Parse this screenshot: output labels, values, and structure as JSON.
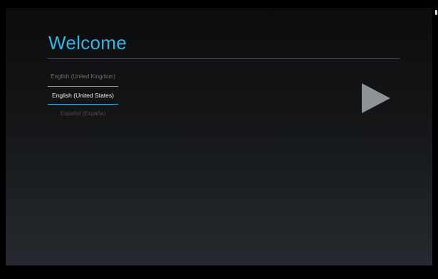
{
  "welcome": {
    "title": "Welcome"
  },
  "languages": {
    "items": [
      {
        "label": "English (United Kingdom)"
      },
      {
        "label": "English (United States)"
      },
      {
        "label": "Español (España)"
      }
    ],
    "selected": "English (United States)"
  },
  "next": {
    "icon": "play-arrow-icon"
  },
  "colors": {
    "accent": "#33b5e5",
    "arrow": "#8f9296"
  }
}
